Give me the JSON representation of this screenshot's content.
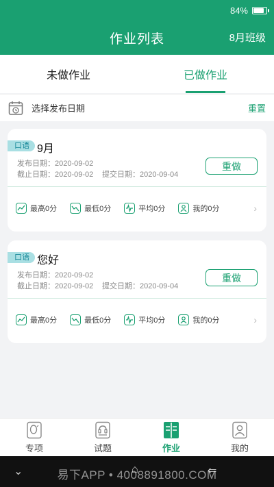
{
  "status": {
    "battery": "84%",
    "battery_level": 0.84
  },
  "header": {
    "title": "作业列表",
    "class_name": "8月班级"
  },
  "tabs": [
    {
      "label": "未做作业",
      "active": false
    },
    {
      "label": "已做作业",
      "active": true
    }
  ],
  "filter": {
    "label": "选择发布日期",
    "reset": "重置"
  },
  "cards": [
    {
      "tag": "口语",
      "name": "9月",
      "publish": "发布日期：2020-09-02",
      "deadline": "截止日期：2020-09-02",
      "submit": "提交日期：2020-09-04",
      "action": "重做",
      "stats": {
        "highest": "最高0分",
        "lowest": "最低0分",
        "average": "平均0分",
        "mine": "我的0分"
      }
    },
    {
      "tag": "口语",
      "name": "您好",
      "publish": "发布日期：2020-09-02",
      "deadline": "截止日期：2020-09-02",
      "submit": "提交日期：2020-09-04",
      "action": "重做",
      "stats": {
        "highest": "最高0分",
        "lowest": "最低0分",
        "average": "平均0分",
        "mine": "我的0分"
      }
    }
  ],
  "nav": [
    {
      "label": "专项",
      "icon": "special-icon"
    },
    {
      "label": "试题",
      "icon": "exam-icon"
    },
    {
      "label": "作业",
      "icon": "homework-icon",
      "active": true
    },
    {
      "label": "我的",
      "icon": "profile-icon"
    }
  ],
  "system_bar": {
    "watermark": "易下APP • 4008891800.COM"
  },
  "colors": {
    "brand": "#1aa071",
    "tag_bg": "#a9dfe3"
  }
}
